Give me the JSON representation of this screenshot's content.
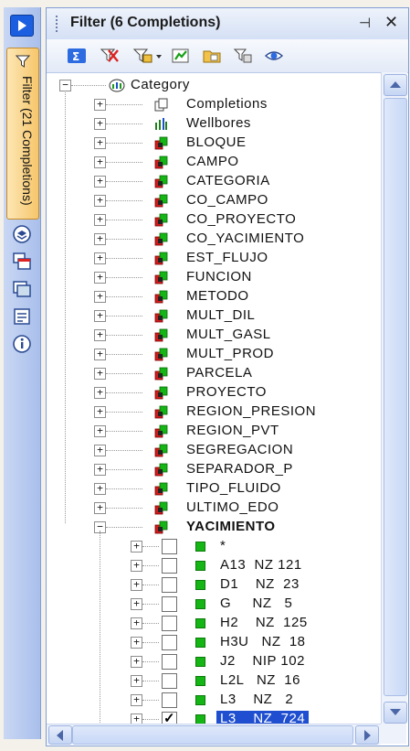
{
  "sidebar": {
    "tab_label": "Filter (21 Completions)"
  },
  "panel": {
    "title": "Filter (6 Completions)",
    "pin_glyph": "ᵖ",
    "close_glyph": "✕"
  },
  "tree": {
    "root": "Category",
    "nodes": [
      {
        "label": "Completions",
        "icon": "completions-icon"
      },
      {
        "label": "Wellbores",
        "icon": "wellbores-icon"
      },
      {
        "label": "BLOQUE",
        "icon": "cube-icon"
      },
      {
        "label": "CAMPO",
        "icon": "cube-icon"
      },
      {
        "label": "CATEGORIA",
        "icon": "cube-icon"
      },
      {
        "label": "CO_CAMPO",
        "icon": "cube-icon"
      },
      {
        "label": "CO_PROYECTO",
        "icon": "cube-icon"
      },
      {
        "label": "CO_YACIMIENTO",
        "icon": "cube-icon"
      },
      {
        "label": "EST_FLUJO",
        "icon": "cube-icon"
      },
      {
        "label": "FUNCION",
        "icon": "cube-icon"
      },
      {
        "label": "METODO",
        "icon": "cube-icon"
      },
      {
        "label": "MULT_DIL",
        "icon": "cube-icon"
      },
      {
        "label": "MULT_GASL",
        "icon": "cube-icon"
      },
      {
        "label": "MULT_PROD",
        "icon": "cube-icon"
      },
      {
        "label": "PARCELA",
        "icon": "cube-icon"
      },
      {
        "label": "PROYECTO",
        "icon": "cube-icon"
      },
      {
        "label": "REGION_PRESION",
        "icon": "cube-icon"
      },
      {
        "label": "REGION_PVT",
        "icon": "cube-icon"
      },
      {
        "label": "SEGREGACION",
        "icon": "cube-icon"
      },
      {
        "label": "SEPARADOR_P",
        "icon": "cube-icon"
      },
      {
        "label": "TIPO_FLUIDO",
        "icon": "cube-icon"
      },
      {
        "label": "ULTIMO_EDO",
        "icon": "cube-icon"
      },
      {
        "label": "YACIMIENTO",
        "icon": "cube-icon",
        "bold": true,
        "expanded": true
      }
    ],
    "children": [
      {
        "label": "*",
        "checked": false
      },
      {
        "label": "A13  NZ 121",
        "checked": false
      },
      {
        "label": "D1    NZ  23",
        "checked": false
      },
      {
        "label": "G     NZ   5",
        "checked": false
      },
      {
        "label": "H2    NZ  125",
        "checked": false
      },
      {
        "label": "H3U   NZ  18",
        "checked": false
      },
      {
        "label": "J2    NIP 102",
        "checked": false
      },
      {
        "label": "L2L   NZ  16",
        "checked": false
      },
      {
        "label": "L3    NZ   2",
        "checked": false
      },
      {
        "label": "L3    NZ  724",
        "checked": true,
        "selected": true
      }
    ]
  },
  "colors": {
    "accent": "#1f4fd0",
    "tab_orange": "#f6c66b",
    "cube_red": "#d21c1c",
    "cube_green": "#14b514"
  }
}
